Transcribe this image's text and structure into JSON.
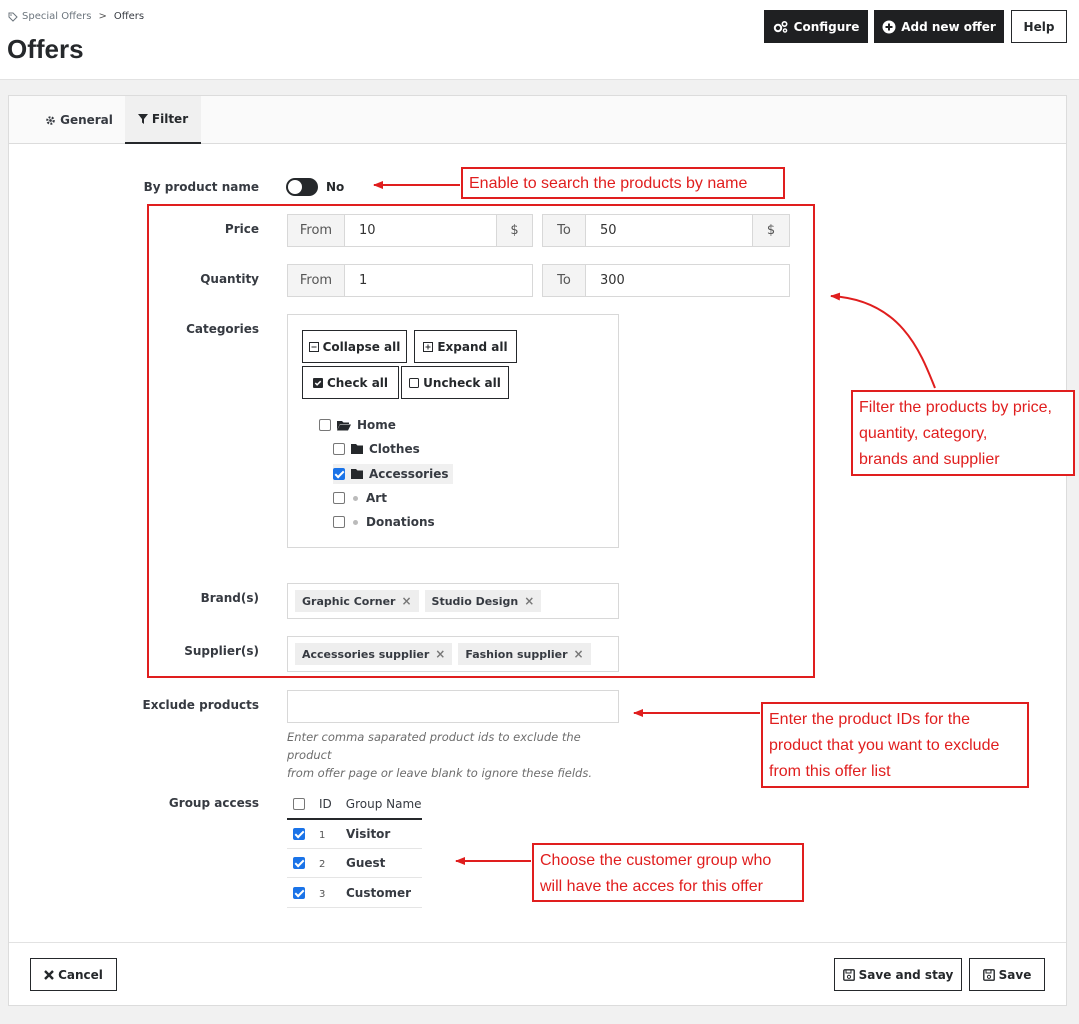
{
  "breadcrumb": {
    "parent": "Special Offers",
    "separator": ">",
    "current": "Offers"
  },
  "page_title": "Offers",
  "toolbar": {
    "configure_label": "Configure",
    "add_label": "Add new offer",
    "help_label": "Help"
  },
  "tabs": [
    {
      "label": "General",
      "active": false
    },
    {
      "label": "Filter",
      "active": true
    }
  ],
  "form": {
    "by_product_name": {
      "label": "By product name",
      "value": "No"
    },
    "price": {
      "label": "Price",
      "from_label": "From",
      "from_value": "10",
      "to_label": "To",
      "to_value": "50",
      "currency": "$"
    },
    "quantity": {
      "label": "Quantity",
      "from_label": "From",
      "from_value": "1",
      "to_label": "To",
      "to_value": "300"
    },
    "categories": {
      "label": "Categories",
      "collapse_label": "Collapse all",
      "expand_label": "Expand all",
      "check_label": "Check all",
      "uncheck_label": "Uncheck all",
      "tree": [
        {
          "label": "Home",
          "checked": false,
          "icon": "folder-open-icon"
        },
        {
          "label": "Clothes",
          "checked": false,
          "icon": "folder-icon"
        },
        {
          "label": "Accessories",
          "checked": true,
          "icon": "folder-icon"
        },
        {
          "label": "Art",
          "checked": false,
          "icon": "leaf-dot-icon"
        },
        {
          "label": "Donations",
          "checked": false,
          "icon": "leaf-dot-icon"
        }
      ]
    },
    "brands": {
      "label": "Brand(s)",
      "tags": [
        "Graphic Corner",
        "Studio Design"
      ],
      "remove_glyph": "×"
    },
    "suppliers": {
      "label": "Supplier(s)",
      "tags": [
        "Accessories supplier",
        "Fashion supplier"
      ],
      "remove_glyph": "×"
    },
    "exclude": {
      "label": "Exclude products",
      "value": "",
      "help_line1": "Enter comma saparated product ids to exclude the product",
      "help_line2": "from offer page or leave blank to ignore these fields."
    },
    "group_access": {
      "label": "Group access",
      "headers": {
        "id": "ID",
        "name": "Group Name"
      },
      "rows": [
        {
          "id": "1",
          "name": "Visitor",
          "checked": true
        },
        {
          "id": "2",
          "name": "Guest",
          "checked": true
        },
        {
          "id": "3",
          "name": "Customer",
          "checked": true
        }
      ]
    }
  },
  "footer": {
    "cancel_label": "Cancel",
    "save_stay_label": "Save and stay",
    "save_label": "Save"
  },
  "annotations": {
    "name_search": "Enable to search the products by name",
    "filter_line1": "Filter the products by price,",
    "filter_line2": "quantity, category,",
    "filter_line3": "brands and supplier",
    "exclude_line1": "Enter the product IDs for the",
    "exclude_line2": "product that you want to exclude",
    "exclude_line3": "from this offer list",
    "group_line1": "Choose the customer group who",
    "group_line2": "will have the acces for this offer",
    "color": "#e01e1e"
  },
  "colors": {
    "dark_button": "#1f2022",
    "checkbox_checked": "#1a73e8"
  }
}
